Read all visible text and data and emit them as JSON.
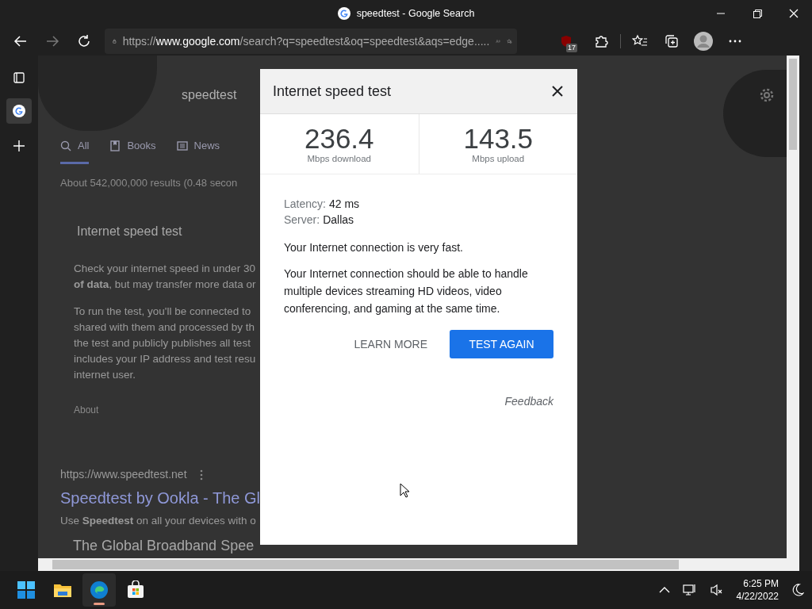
{
  "window": {
    "title": "speedtest - Google Search"
  },
  "toolbar": {
    "url_scheme": "https://",
    "url_host": "www.google.com",
    "url_rest": "/search?q=speedtest&oq=speedtest&aqs=edge.....",
    "extension_badge": "17"
  },
  "sidebar_tabs": [
    {
      "kind": "actions",
      "selected": false
    },
    {
      "kind": "site",
      "selected": true
    },
    {
      "kind": "new",
      "selected": false
    }
  ],
  "page": {
    "search_query": "speedtest",
    "search_tabs": [
      {
        "label": "All",
        "selected": true
      },
      {
        "label": "Books",
        "selected": false
      },
      {
        "label": "News",
        "selected": false
      }
    ],
    "result_stats": "About 542,000,000 results (0.48 secon",
    "card_title": "Internet speed test",
    "paragraphs": [
      [
        "Check your internet speed in under 30",
        "**of data**, but may transfer more data or"
      ],
      [
        "To run the test, you'll be connected to",
        "shared with them and processed by th",
        "the test and publicly publishes all test",
        "includes your IP address and test resu",
        "internet user."
      ]
    ],
    "about_link": "About",
    "result": {
      "url": "https://www.speedtest.net",
      "title": "Speedtest by Ookla - The Gl",
      "snippet": "Use **Speedtest** on all your devices with o",
      "next_title": "The Global Broadband Spee"
    }
  },
  "dialog": {
    "title": "Internet speed test",
    "stats": [
      {
        "value": "236.4",
        "unit": "Mbps download"
      },
      {
        "value": "143.5",
        "unit": "Mbps upload"
      }
    ],
    "details": [
      {
        "label": "Latency:",
        "value": "42 ms"
      },
      {
        "label": "Server:",
        "value": "Dallas"
      }
    ],
    "verdict": "Your Internet connection is very fast.",
    "explanation": "Your Internet connection should be able to handle multiple devices streaming HD videos, video conferencing, and gaming at the same time.",
    "buttons": [
      {
        "label": "LEARN MORE",
        "kind": "text"
      },
      {
        "label": "TEST AGAIN",
        "kind": "primary"
      }
    ],
    "feedback": "Feedback"
  },
  "taskbar": {
    "apps": [
      {
        "kind": "start",
        "running": false
      },
      {
        "kind": "explorer",
        "running": false
      },
      {
        "kind": "edge",
        "running": true
      },
      {
        "kind": "store",
        "running": false
      }
    ],
    "time": "6:25 PM",
    "date": "4/22/2022"
  }
}
